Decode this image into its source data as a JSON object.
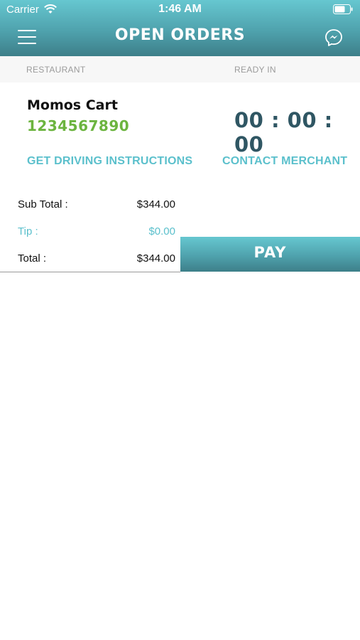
{
  "status_bar": {
    "carrier": "Carrier",
    "time": "1:46 AM"
  },
  "nav": {
    "title": "OPEN ORDERS",
    "menu_icon": "hamburger-menu-icon",
    "chat_icon": "messenger-chat-icon"
  },
  "columns": {
    "restaurant": "RESTAURANT",
    "ready_in": "READY IN"
  },
  "order": {
    "restaurant_name": "Momos Cart",
    "phone": "1234567890",
    "ready_in": "00 : 00 : 00"
  },
  "actions": {
    "driving": "GET DRIVING INSTRUCTIONS",
    "contact": "CONTACT MERCHANT"
  },
  "totals": {
    "sub_total_label": "Sub Total :",
    "sub_total_value": "$344.00",
    "tip_label": "Tip :",
    "tip_value": "$0.00",
    "total_label": "Total :",
    "total_value": "$344.00"
  },
  "pay": {
    "label": "PAY"
  },
  "colors": {
    "header_gradient_top": "#66c7d0",
    "header_gradient_bottom": "#3d7f89",
    "accent_teal": "#5bc0cc",
    "phone_green": "#6cb43f",
    "timer_dark": "#2f5663"
  }
}
